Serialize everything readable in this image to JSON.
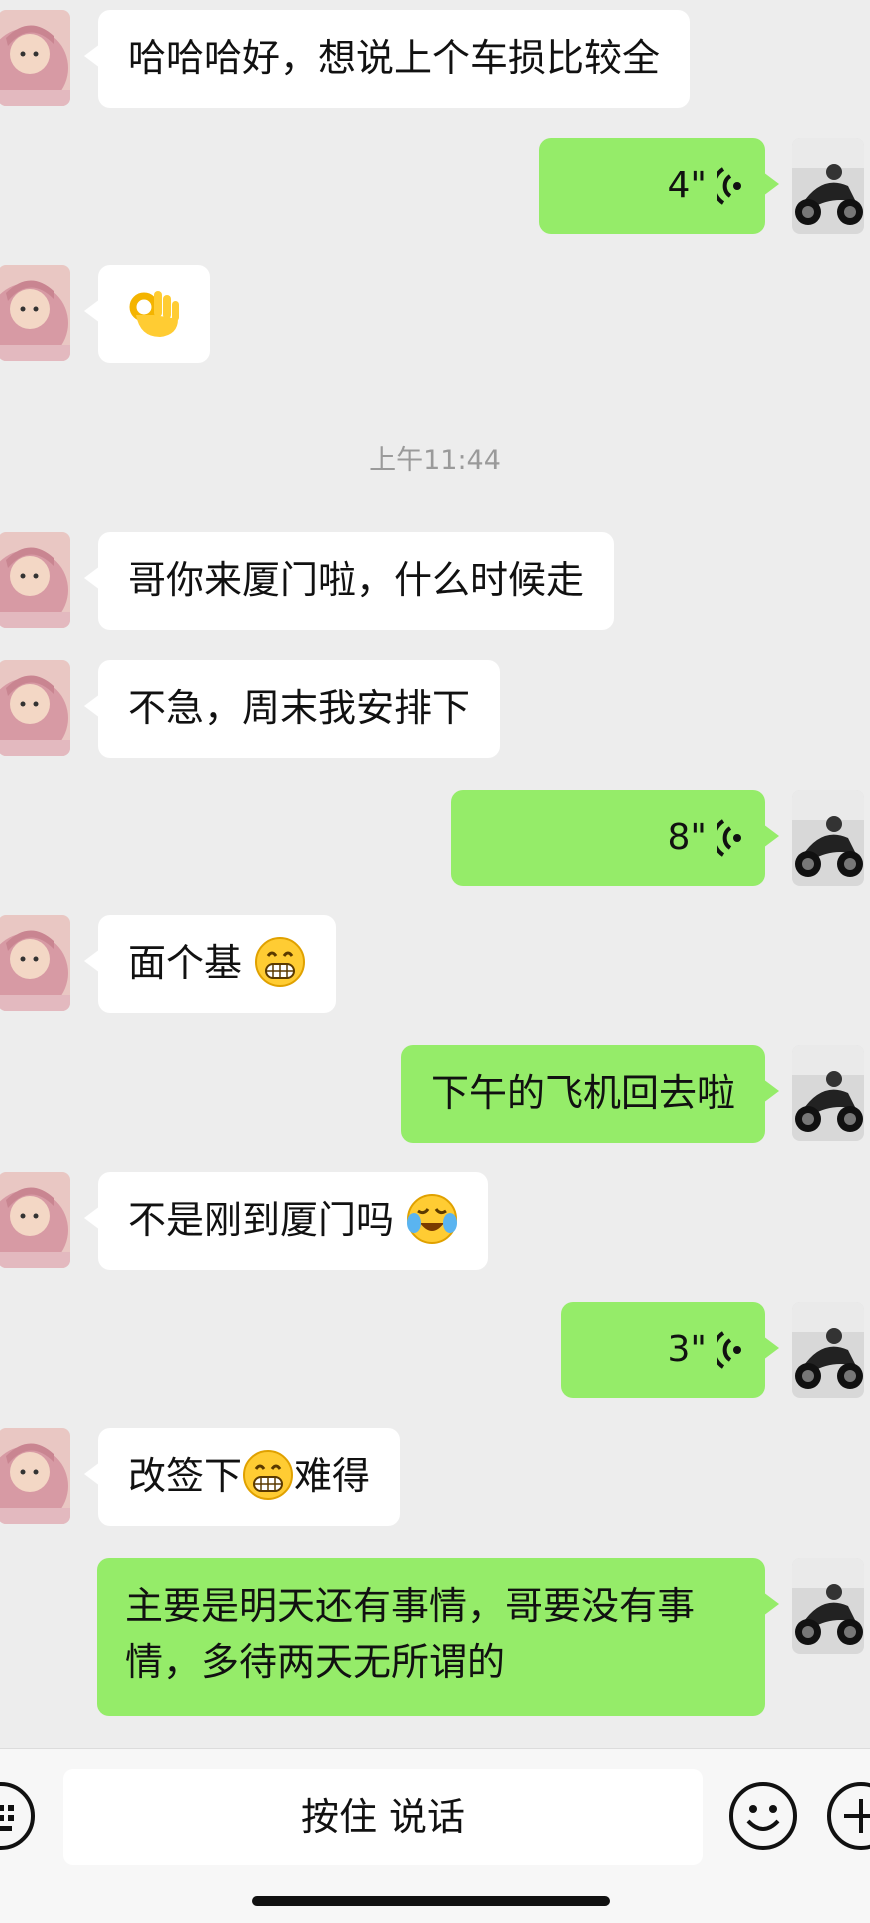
{
  "messages": [
    {
      "side": "left",
      "text": "哈哈哈好，想说上个车损比较全"
    },
    {
      "side": "right",
      "type": "voice",
      "duration": "4\""
    },
    {
      "side": "left",
      "type": "emoji",
      "emoji": "ok-hand-emoji"
    },
    {
      "side": "left",
      "text": "哥你来厦门啦，什么时候走"
    },
    {
      "side": "left",
      "text": "不急，周末我安排下"
    },
    {
      "side": "right",
      "type": "voice",
      "duration": "8\""
    },
    {
      "side": "left",
      "text": "面个基"
    },
    {
      "side": "right",
      "text": "下午的飞机回去啦"
    },
    {
      "side": "left",
      "text": "不是刚到厦门吗"
    },
    {
      "side": "right",
      "type": "voice",
      "duration": "3\""
    },
    {
      "side": "left",
      "text_before": "改签下",
      "text_after": "难得"
    },
    {
      "side": "right",
      "text": "主要是明天还有事情，哥要没有事情，多待两天无所谓的"
    }
  ],
  "timestamp": "上午11:44",
  "input_bar": {
    "hold_to_talk": "按住 说话",
    "left_icon": "keyboard-icon",
    "emoji_icon": "smile-icon",
    "plus_icon": "plus-icon"
  },
  "colors": {
    "background": "#ededed",
    "sent_bubble": "#95ec69",
    "received_bubble": "#ffffff",
    "timestamp_text": "#9a9a9a"
  }
}
